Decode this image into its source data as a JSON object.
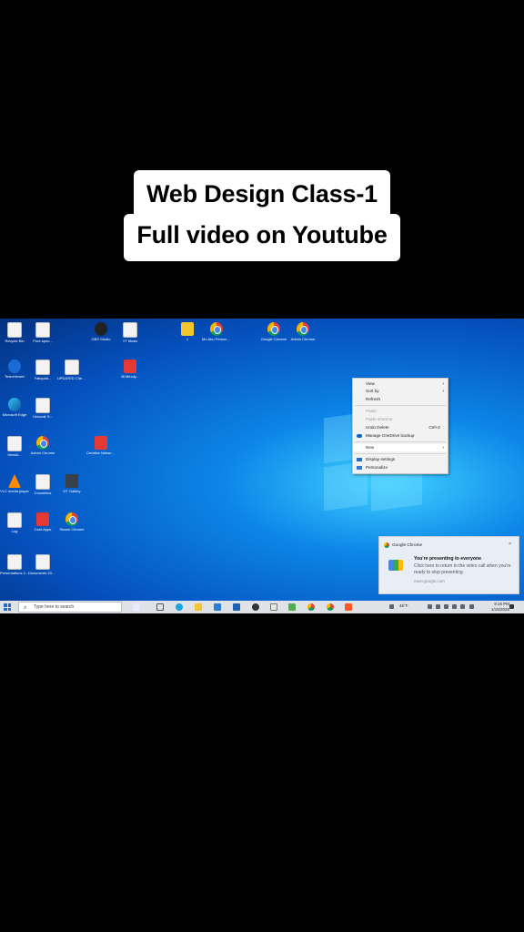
{
  "caption": {
    "line1": "Web Design Class-1",
    "line2": "Full video on Youtube"
  },
  "desktop_icons": [
    {
      "label": "Recycle Bin",
      "icon": "recycle-bin-icon",
      "style": "ic-file",
      "col": 0,
      "row": 0
    },
    {
      "label": "Pure-spec...",
      "icon": "file-icon",
      "style": "ic-file",
      "col": 1,
      "row": 0
    },
    {
      "label": "OBS Studio",
      "icon": "obs-icon",
      "style": "ic-obs",
      "col": 3,
      "row": 0
    },
    {
      "label": "YT Music",
      "icon": "file-icon",
      "style": "ic-file",
      "col": 4,
      "row": 0
    },
    {
      "label": "1",
      "icon": "file-icon",
      "style": "ic-yellow",
      "col": 6,
      "row": 0
    },
    {
      "label": "Mo Abu Personal...",
      "icon": "chrome-icon",
      "style": "ic-chrome",
      "col": 7,
      "row": 0
    },
    {
      "label": "Google Chrome",
      "icon": "chrome-icon",
      "style": "ic-chrome",
      "col": 9,
      "row": 0
    },
    {
      "label": "Admin Chrome",
      "icon": "chrome-icon",
      "style": "ic-chrome",
      "col": 10,
      "row": 0
    },
    {
      "label": "TeamViewer",
      "icon": "teamviewer-icon",
      "style": "ic-tv",
      "col": 0,
      "row": 1
    },
    {
      "label": "Fatiquidi...",
      "icon": "file-icon",
      "style": "ic-file",
      "col": 1,
      "row": 1
    },
    {
      "label": "UPDATED Client rates...",
      "icon": "file-icon",
      "style": "ic-file",
      "col": 2,
      "row": 1
    },
    {
      "label": "Bi Minoly...",
      "icon": "file-icon",
      "style": "ic-red",
      "col": 4,
      "row": 1
    },
    {
      "label": "Microsoft Edge",
      "icon": "edge-icon",
      "style": "ic-edge",
      "col": 0,
      "row": 2
    },
    {
      "label": "Unicode S...",
      "icon": "file-icon",
      "style": "ic-file",
      "col": 1,
      "row": 2
    },
    {
      "label": "Haruki...",
      "icon": "file-icon",
      "style": "ic-file",
      "col": 0,
      "row": 3
    },
    {
      "label": "Admin Chrome",
      "icon": "chrome-icon",
      "style": "ic-chrome",
      "col": 1,
      "row": 3
    },
    {
      "label": "Creative Network...",
      "icon": "app-icon",
      "style": "ic-red",
      "col": 3,
      "row": 3
    },
    {
      "label": "VLC media player",
      "icon": "vlc-icon",
      "style": "ic-vlc",
      "col": 0,
      "row": 4
    },
    {
      "label": "Cosmetics",
      "icon": "file-icon",
      "style": "ic-file",
      "col": 1,
      "row": 4
    },
    {
      "label": "DT Gallery",
      "icon": "app-icon",
      "style": "ic-dark",
      "col": 2,
      "row": 4
    },
    {
      "label": "Log",
      "icon": "file-icon",
      "style": "ic-file",
      "col": 0,
      "row": 5
    },
    {
      "label": "Card Apps",
      "icon": "app-icon",
      "style": "ic-red",
      "col": 1,
      "row": 5
    },
    {
      "label": "Steam Chrome",
      "icon": "chrome-icon",
      "style": "ic-chrome",
      "col": 2,
      "row": 5
    },
    {
      "label": "Presentations 2025...",
      "icon": "file-icon",
      "style": "ic-file",
      "col": 0,
      "row": 6
    },
    {
      "label": "Documents 2025...",
      "icon": "file-icon",
      "style": "ic-file",
      "col": 1,
      "row": 6
    }
  ],
  "context_menu": {
    "items": [
      {
        "label": "View",
        "arrow": "›",
        "disabled": false
      },
      {
        "label": "Sort by",
        "arrow": "›",
        "disabled": false
      },
      {
        "label": "Refresh",
        "disabled": false
      },
      {
        "label": "Paste",
        "disabled": true
      },
      {
        "label": "Paste shortcut",
        "disabled": true
      },
      {
        "label": "Undo Delete",
        "shortcut": "Ctrl+Z",
        "disabled": false
      },
      {
        "label": "Manage OneDrive backup",
        "disabled": false
      },
      {
        "label": "New",
        "arrow": "›",
        "disabled": false,
        "highlight": true
      },
      {
        "label": "Display settings",
        "disabled": false
      },
      {
        "label": "Personalize",
        "disabled": false
      }
    ]
  },
  "toast": {
    "app": "Google Chrome",
    "close": "×",
    "title": "You're presenting to everyone",
    "body": "Click here to return to the video call when you're ready to stop presenting",
    "source": "meet.google.com"
  },
  "taskbar": {
    "search_placeholder": "Type here to search",
    "weather": "46°F",
    "time": "9:16 PM",
    "date": "1/15/2025"
  },
  "colors": {
    "accent": "#1f6fd1",
    "desktop_blue": "#0c86e8"
  }
}
